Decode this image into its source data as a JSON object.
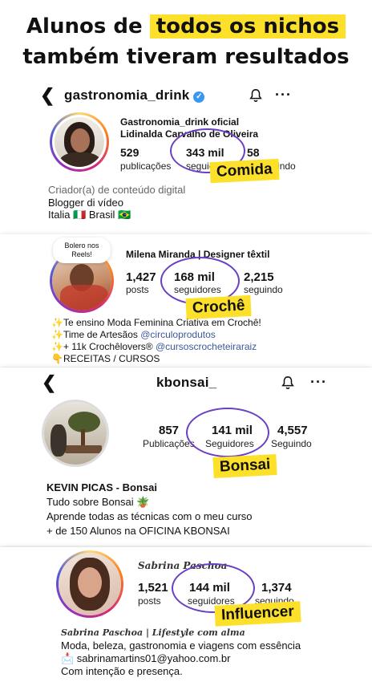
{
  "headline": {
    "line1_prefix": "Alunos de",
    "line1_highlight": "todos os nichos",
    "line2": "também tiveram resultados"
  },
  "profile1": {
    "username": "gastronomia_drink",
    "display_name": "Gastronomia_drink oficial",
    "full_name": "Lidinalda Carvalho de Oliveira",
    "posts": "529",
    "posts_label": "publicações",
    "followers": "343 mil",
    "followers_label": "seguidores",
    "following": "58",
    "following_label": "seguindo",
    "category": "Criador(a) de conteúdo digital",
    "bio1": "Blogger di vídeo",
    "bio2": "Italia 🇮🇹 Brasil 🇧🇷",
    "tag": "Comida"
  },
  "profile2": {
    "bubble": "Bolero nos Reels!",
    "name": "Milena Miranda | Designer têxtil",
    "posts": "1,427",
    "posts_label": "posts",
    "followers": "168 mil",
    "followers_label": "seguidores",
    "following": "2,215",
    "following_label": "seguindo",
    "bio1": "✨Te ensino Moda Feminina Criativa em Crochê!",
    "bio2_prefix": "✨Time de Artesãos ",
    "bio2_link": "@circuloprodutos",
    "bio3_prefix": "✨+ 11k Crochêlovers® ",
    "bio3_link": "@cursoscrocheteiraraiz",
    "bio4": "👇RECEITAS / CURSOS",
    "tag": "Crochê"
  },
  "profile3": {
    "username": "kbonsai_",
    "posts": "857",
    "posts_label": "Publicações",
    "followers": "141 mil",
    "followers_label": "Seguidores",
    "following": "4,557",
    "following_label": "Seguindo",
    "name": "KEVIN PICAS - Bonsai",
    "bio1": "Tudo sobre Bonsai 🪴",
    "bio2": "Aprende todas as técnicas com o meu curso",
    "bio3": "+ de 150 Alunos na OFICINA KBONSAI",
    "tag": "Bonsai"
  },
  "profile4": {
    "header_name": "Sabrina Paschoa",
    "posts": "1,521",
    "posts_label": "posts",
    "followers": "144 mil",
    "followers_label": "seguidores",
    "following": "1,374",
    "following_label": "seguindo",
    "name_line": "Sabrina Paschoa | Lifestyle com alma",
    "bio1": "Moda, beleza, gastronomia e viagens com essência",
    "bio2": "📩 sabrinamartins01@yahoo.com.br",
    "bio3": "Com intenção e presença.",
    "tag": "Influencer"
  },
  "colors": {
    "highlight": "#fde02a",
    "circle": "#6a3fc4",
    "link": "#3b5998",
    "verified": "#3897f0"
  },
  "icons": {
    "back": "back-arrow-icon",
    "bell": "bell-icon",
    "more": "more-icon",
    "verified": "verified-badge-icon"
  }
}
